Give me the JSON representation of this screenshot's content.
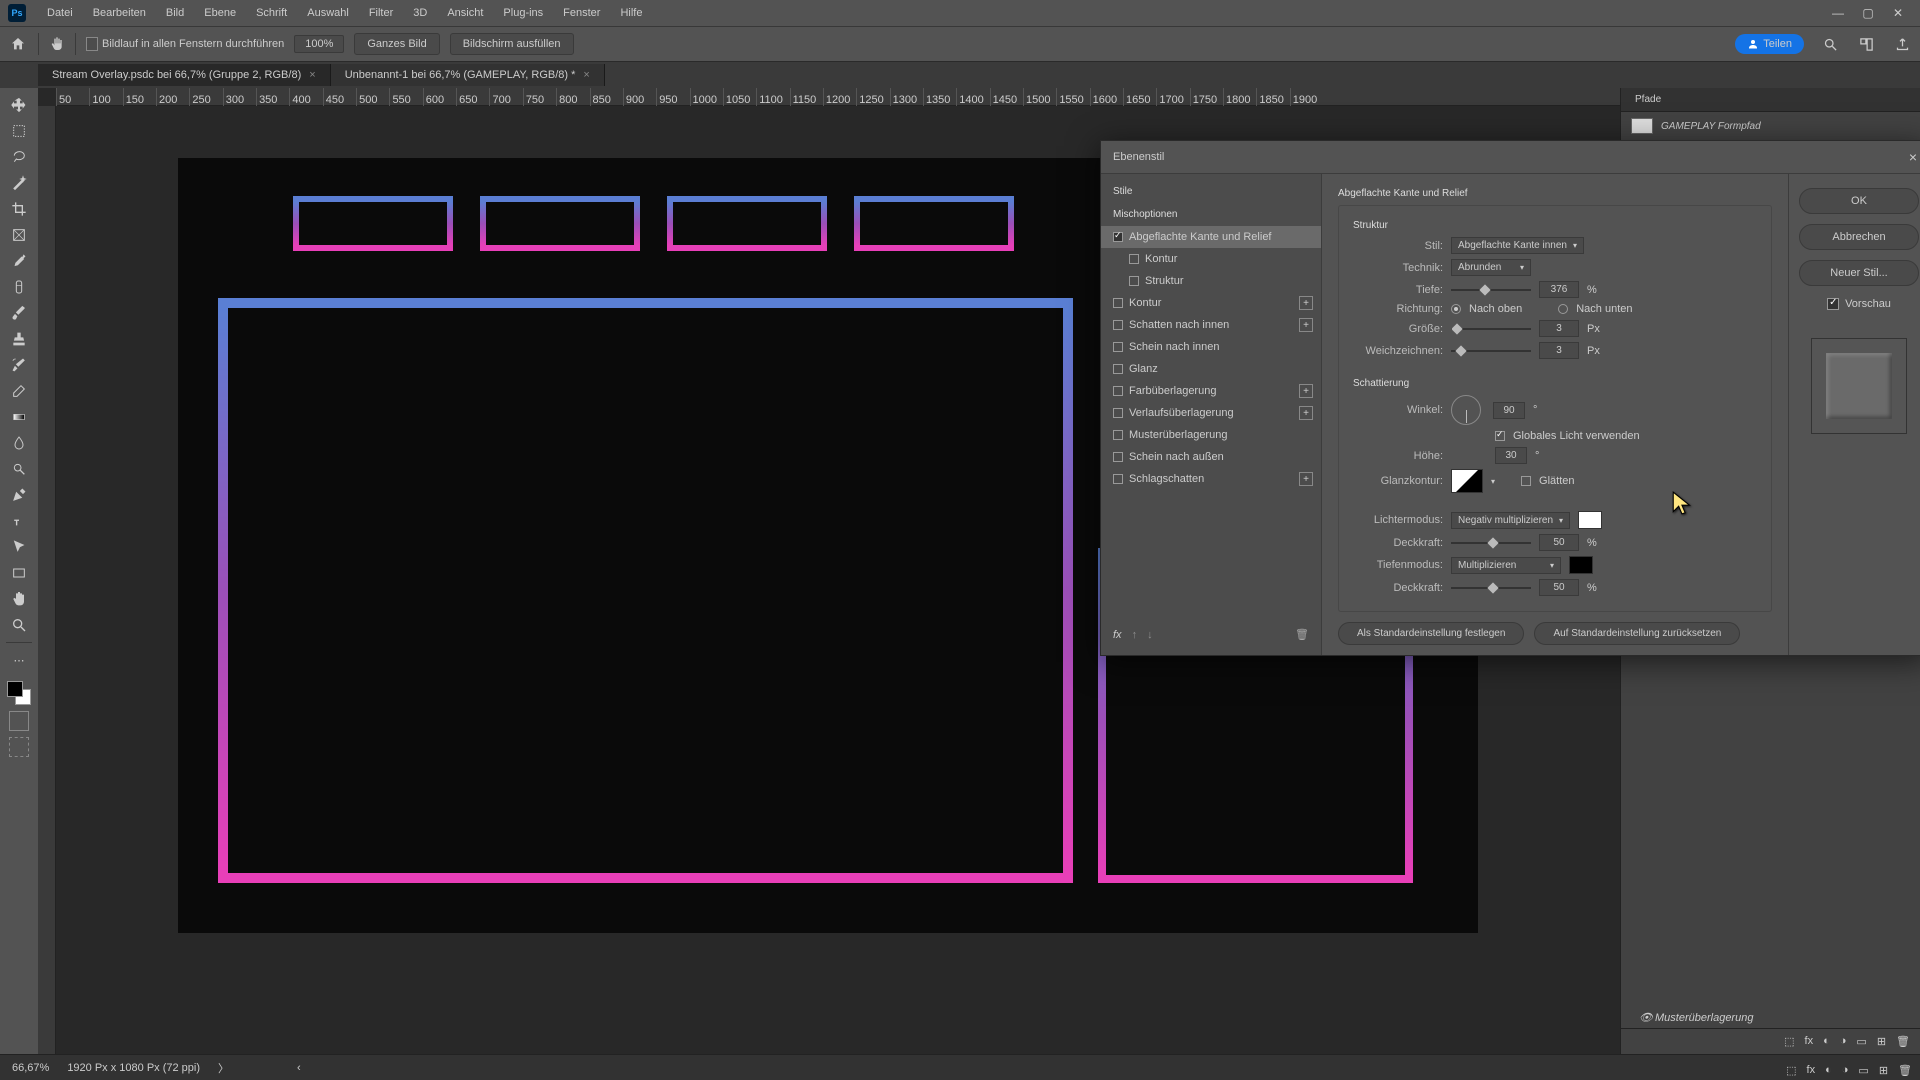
{
  "menu": {
    "items": [
      "Datei",
      "Bearbeiten",
      "Bild",
      "Ebene",
      "Schrift",
      "Auswahl",
      "Filter",
      "3D",
      "Ansicht",
      "Plug-ins",
      "Fenster",
      "Hilfe"
    ],
    "ps": "Ps"
  },
  "optbar": {
    "scroll_all": "Bildlauf in allen Fenstern durchführen",
    "zoom": "100%",
    "fit": "Ganzes Bild",
    "fill": "Bildschirm ausfüllen",
    "share": "Teilen"
  },
  "tabs": [
    {
      "label": "Stream Overlay.psdc bei 66,7% (Gruppe 2, RGB/8)",
      "active": false
    },
    {
      "label": "Unbenannt-1 bei 66,7% (GAMEPLAY, RGB/8) *",
      "active": true
    }
  ],
  "ruler_ticks": [
    "50",
    "100",
    "150",
    "200",
    "250",
    "300",
    "350",
    "400",
    "450",
    "500",
    "550",
    "600",
    "650",
    "700",
    "750",
    "800",
    "850",
    "900",
    "950",
    "1000",
    "1050",
    "1100",
    "1150",
    "1200",
    "1250",
    "1300",
    "1350",
    "1400",
    "1450",
    "1500",
    "1550",
    "1600",
    "1650",
    "1700",
    "1750",
    "1800",
    "1850",
    "1900"
  ],
  "paths": {
    "tab": "Pfade",
    "item": "GAMEPLAY Formpfad",
    "extra": "Musterüberlagerung"
  },
  "status": {
    "zoom": "66,67%",
    "doc": "1920 Px x 1080 Px (72 ppi)"
  },
  "dialog": {
    "title": "Ebenenstil",
    "left": {
      "stile": "Stile",
      "misch": "Mischoptionen",
      "rows": [
        {
          "k": "bevel",
          "label": "Abgeflachte Kante und Relief",
          "checked": true,
          "active": true
        },
        {
          "k": "kontur_sub",
          "label": "Kontur",
          "sub": true
        },
        {
          "k": "struktur_sub",
          "label": "Struktur",
          "sub": true
        },
        {
          "k": "kontur",
          "label": "Kontur",
          "plus": true
        },
        {
          "k": "inner_shadow",
          "label": "Schatten nach innen",
          "plus": true
        },
        {
          "k": "inner_glow",
          "label": "Schein nach innen"
        },
        {
          "k": "glanz",
          "label": "Glanz"
        },
        {
          "k": "color_ov",
          "label": "Farbüberlagerung",
          "plus": true
        },
        {
          "k": "grad_ov",
          "label": "Verlaufsüberlagerung",
          "plus": true
        },
        {
          "k": "pat_ov",
          "label": "Musterüberlagerung"
        },
        {
          "k": "outer_glow",
          "label": "Schein nach außen"
        },
        {
          "k": "drop_shadow",
          "label": "Schlagschatten",
          "plus": true
        }
      ]
    },
    "mid": {
      "header": "Abgeflachte Kante und Relief",
      "struktur": "Struktur",
      "stil_lbl": "Stil:",
      "stil_val": "Abgeflachte Kante innen",
      "technik_lbl": "Technik:",
      "technik_val": "Abrunden",
      "tiefe_lbl": "Tiefe:",
      "tiefe_val": "376",
      "pct": "%",
      "richtung_lbl": "Richtung:",
      "up": "Nach oben",
      "down": "Nach unten",
      "groesse_lbl": "Größe:",
      "groesse_val": "3",
      "px": "Px",
      "weich_lbl": "Weichzeichnen:",
      "weich_val": "3",
      "schatt": "Schattierung",
      "winkel_lbl": "Winkel:",
      "winkel_val": "90",
      "deg": "°",
      "global": "Globales Licht verwenden",
      "hoehe_lbl": "Höhe:",
      "hoehe_val": "30",
      "glanzk_lbl": "Glanzkontur:",
      "glaetten": "Glätten",
      "licht_lbl": "Lichtermodus:",
      "licht_val": "Negativ multiplizieren",
      "deck_lbl": "Deckkraft:",
      "deck_val": "50",
      "tief_lbl": "Tiefenmodus:",
      "tief_val": "Multiplizieren",
      "deck2_val": "50",
      "btn1": "Als Standardeinstellung festlegen",
      "btn2": "Auf Standardeinstellung zurücksetzen"
    },
    "right": {
      "ok": "OK",
      "cancel": "Abbrechen",
      "new": "Neuer Stil...",
      "preview": "Vorschau"
    }
  }
}
